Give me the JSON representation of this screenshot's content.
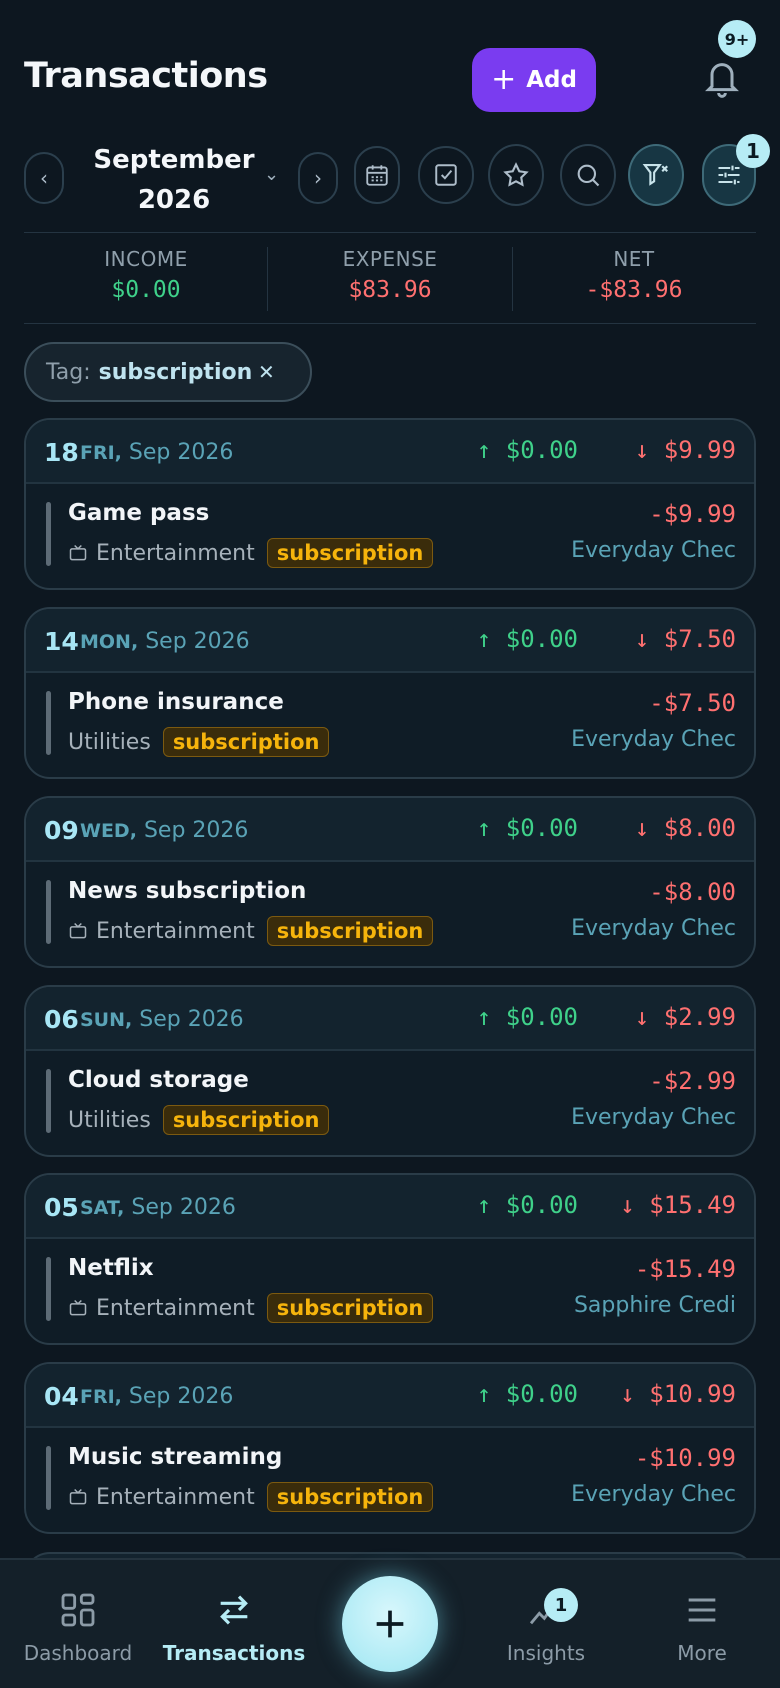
{
  "header": {
    "title": "Transactions",
    "add_label": "Add",
    "notification_count": "9+"
  },
  "toolbar": {
    "prev": "‹",
    "next": "›",
    "month_line1": "September",
    "month_line2": "2026",
    "filter_count": "1"
  },
  "summary": {
    "income_label": "INCOME",
    "income_value": "$0.00",
    "expense_label": "EXPENSE",
    "expense_value": "$83.96",
    "net_label": "NET",
    "net_value": "-$83.96"
  },
  "tag_filter": {
    "label": "Tag:",
    "value": "subscription",
    "clear": "✕"
  },
  "days": [
    {
      "day": "18",
      "weekday": "FRI,",
      "month_year": "Sep 2026",
      "in": "↑ $0.00",
      "out": "↓ $9.99",
      "tx": {
        "name": "Game pass",
        "category": "Entertainment",
        "category_icon": "tv-icon",
        "tag": "subscription",
        "amount": "-$9.99",
        "account": "Everyday Chec"
      }
    },
    {
      "day": "14",
      "weekday": "MON,",
      "month_year": "Sep 2026",
      "in": "↑ $0.00",
      "out": "↓ $7.50",
      "tx": {
        "name": "Phone insurance",
        "category": "Utilities",
        "category_icon": "",
        "tag": "subscription",
        "amount": "-$7.50",
        "account": "Everyday Chec"
      }
    },
    {
      "day": "09",
      "weekday": "WED,",
      "month_year": "Sep 2026",
      "in": "↑ $0.00",
      "out": "↓ $8.00",
      "tx": {
        "name": "News subscription",
        "category": "Entertainment",
        "category_icon": "tv-icon",
        "tag": "subscription",
        "amount": "-$8.00",
        "account": "Everyday Chec"
      }
    },
    {
      "day": "06",
      "weekday": "SUN,",
      "month_year": "Sep 2026",
      "in": "↑ $0.00",
      "out": "↓ $2.99",
      "tx": {
        "name": "Cloud storage",
        "category": "Utilities",
        "category_icon": "",
        "tag": "subscription",
        "amount": "-$2.99",
        "account": "Everyday Chec"
      }
    },
    {
      "day": "05",
      "weekday": "SAT,",
      "month_year": "Sep 2026",
      "in": "↑ $0.00",
      "out": "↓ $15.49",
      "tx": {
        "name": "Netflix",
        "category": "Entertainment",
        "category_icon": "tv-icon",
        "tag": "subscription",
        "amount": "-$15.49",
        "account": "Sapphire Credi"
      }
    },
    {
      "day": "04",
      "weekday": "FRI,",
      "month_year": "Sep 2026",
      "in": "↑ $0.00",
      "out": "↓ $10.99",
      "tx": {
        "name": "Music streaming",
        "category": "Entertainment",
        "category_icon": "tv-icon",
        "tag": "subscription",
        "amount": "-$10.99",
        "account": "Everyday Chec"
      }
    }
  ],
  "bottom_nav": {
    "items": [
      {
        "label": "Dashboard",
        "icon": "grid-icon"
      },
      {
        "label": "Transactions",
        "icon": "arrows-swap-icon",
        "active": true
      },
      {
        "label": "Insights",
        "icon": "sparkle-chart-icon",
        "badge": "1"
      },
      {
        "label": "More",
        "icon": "menu-icon"
      }
    ],
    "fab_icon": "plus-icon"
  },
  "colors": {
    "background": "#0d1720",
    "accent_purple": "#7a3cf0",
    "accent_cyan": "#b6ecf5",
    "income_green": "#3fd18a",
    "expense_red": "#ff7070",
    "tag_yellow": "#f6b40c"
  }
}
